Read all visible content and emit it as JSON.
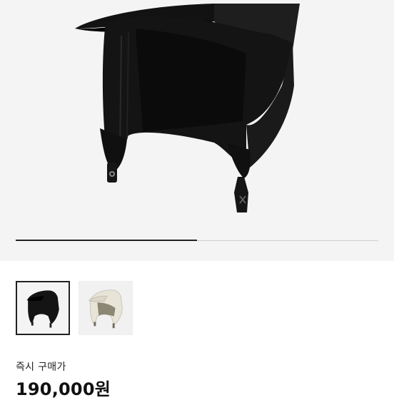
{
  "gallery": {
    "slide_progress": 0.5,
    "thumbnails": [
      {
        "name": "black-cap-thumbnail",
        "color": "black",
        "selected": true
      },
      {
        "name": "ivory-cap-thumbnail",
        "color": "ivory",
        "selected": false
      }
    ]
  },
  "purchase": {
    "label": "즉시 구매가",
    "price": "190,000원"
  }
}
